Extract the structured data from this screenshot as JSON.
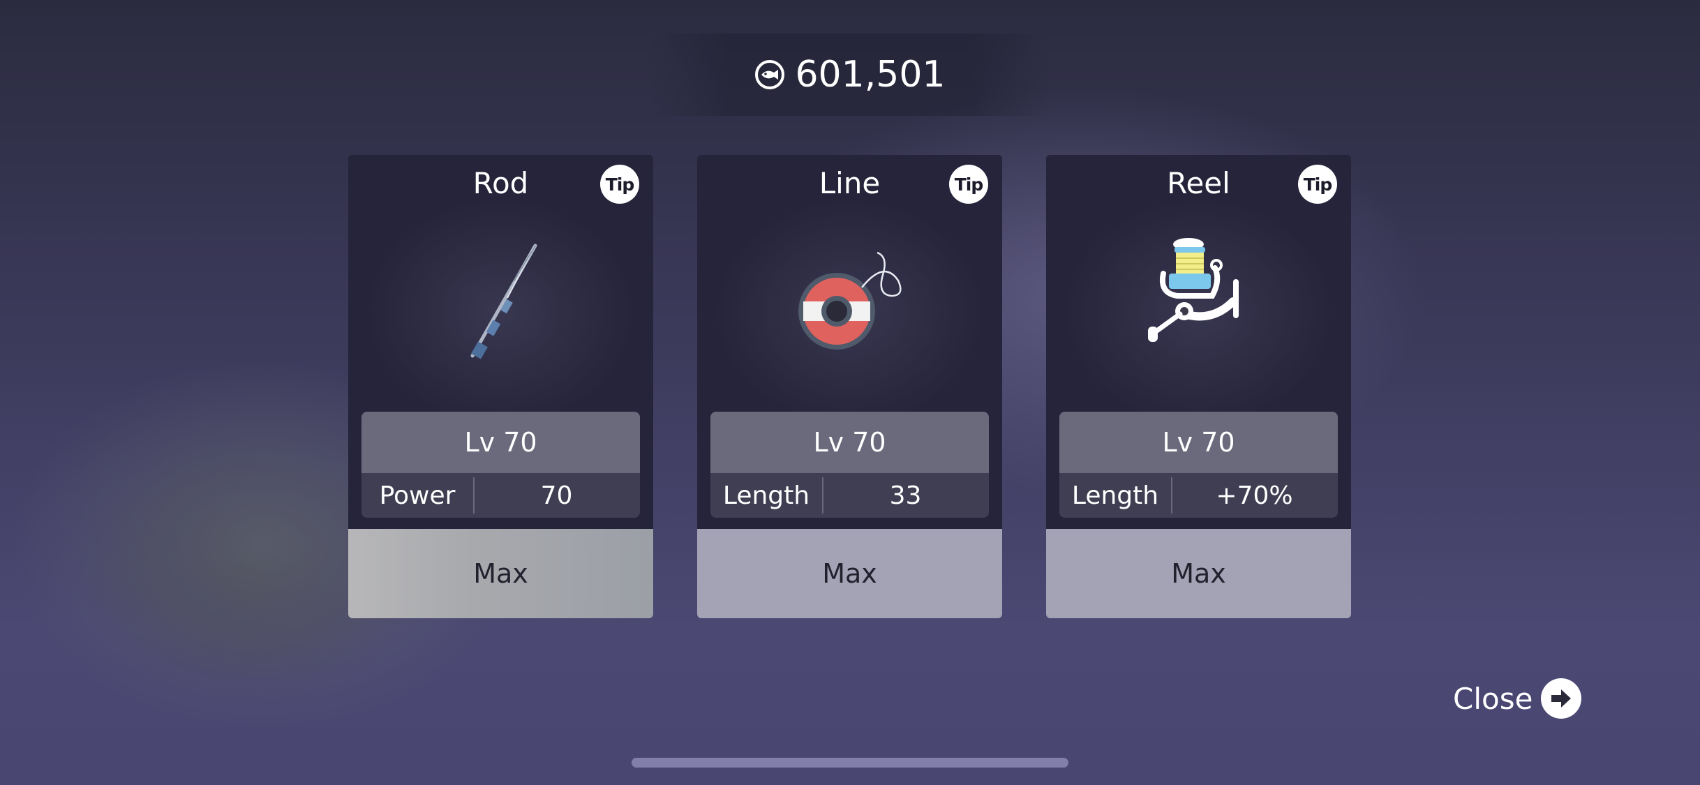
{
  "currency": {
    "icon": "fish-coin-icon",
    "amount": "601,501"
  },
  "cards": [
    {
      "title": "Rod",
      "tip": "Tip",
      "icon": "fishing-rod-icon",
      "level": "Lv 70",
      "stat_name": "Power",
      "stat_value": "70",
      "button": "Max"
    },
    {
      "title": "Line",
      "tip": "Tip",
      "icon": "line-spool-icon",
      "level": "Lv 70",
      "stat_name": "Length",
      "stat_value": "33",
      "button": "Max"
    },
    {
      "title": "Reel",
      "tip": "Tip",
      "icon": "fishing-reel-icon",
      "level": "Lv 70",
      "stat_name": "Length",
      "stat_value": "+70%",
      "button": "Max"
    }
  ],
  "close": {
    "label": "Close",
    "icon": "arrow-right-icon"
  },
  "colors": {
    "card_bg": "#25243a",
    "level_bg": "#6b6a7c",
    "stat_bg": "#3f3e52",
    "button_bg": "#a4a3b6",
    "spool_red": "#e0625e"
  }
}
